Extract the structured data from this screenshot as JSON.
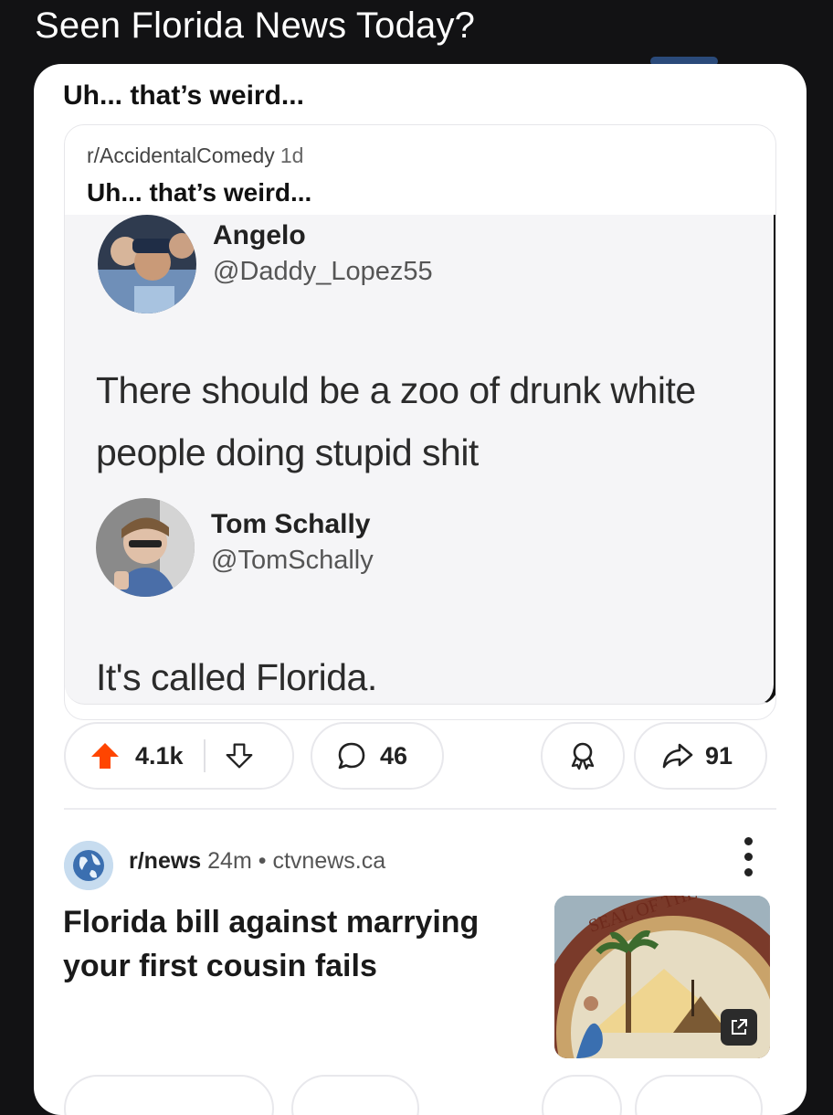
{
  "page": {
    "title": "Seen Florida News Today?"
  },
  "post": {
    "title": "Uh... that’s weird...",
    "embed": {
      "subreddit": "r/AccidentalComedy",
      "age": "1d",
      "title": "Uh... that’s weird...",
      "tweet1": {
        "name": "Angelo",
        "handle": "@Daddy_Lopez55",
        "text_line1": "There should be a zoo of drunk white",
        "text_line2": "people doing stupid shit"
      },
      "tweet2": {
        "name": "Tom Schally",
        "handle": "@TomSchally",
        "text": "It's called Florida."
      }
    },
    "actions": {
      "upvotes": "4.1k",
      "comments": "46",
      "shares": "91"
    }
  },
  "news_post": {
    "subreddit": "r/news",
    "age": "24m",
    "separator": "•",
    "domain": "ctvnews.ca",
    "title": "Florida bill against marrying your first cousin fails",
    "thumb_caption": "SEAL OF THE STATE OF"
  },
  "colors": {
    "background": "#121214",
    "card": "#ffffff",
    "upvote": "#ff4500"
  }
}
